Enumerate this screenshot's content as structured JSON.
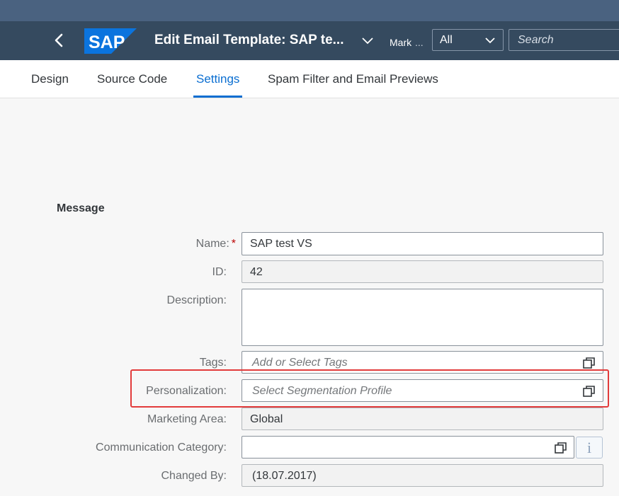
{
  "shell": {
    "title": "Edit Email Template: SAP te...",
    "user_short": "Mark",
    "overflow": "...",
    "scope_value": "All",
    "search_placeholder": "Search",
    "logo_text": "SAP",
    "colors": {
      "shell": "#354a5f",
      "accent": "#0a6ed1",
      "logo_blue": "#0b74de"
    }
  },
  "tabs": [
    {
      "label": "Design"
    },
    {
      "label": "Source Code"
    },
    {
      "label": "Settings",
      "selected": true
    },
    {
      "label": "Spam Filter and Email Previews"
    }
  ],
  "form": {
    "section_title": "Message",
    "name": {
      "label": "Name:",
      "required_mark": "*",
      "value": "SAP test VS"
    },
    "id": {
      "label": "ID:",
      "value": "42"
    },
    "description": {
      "label": "Description:",
      "value": ""
    },
    "tags": {
      "label": "Tags:",
      "placeholder": "Add or Select Tags",
      "icon": "value-help-icon"
    },
    "personalization": {
      "label": "Personalization:",
      "placeholder": "Select Segmentation Profile",
      "icon": "value-help-icon"
    },
    "marketing_area": {
      "label": "Marketing Area:",
      "value": "Global"
    },
    "communication_category": {
      "label": "Communication Category:",
      "value": "",
      "info_glyph": "i",
      "icon": "value-help-icon"
    },
    "changed_by": {
      "label": "Changed By:",
      "value": "(18.07.2017)"
    }
  }
}
